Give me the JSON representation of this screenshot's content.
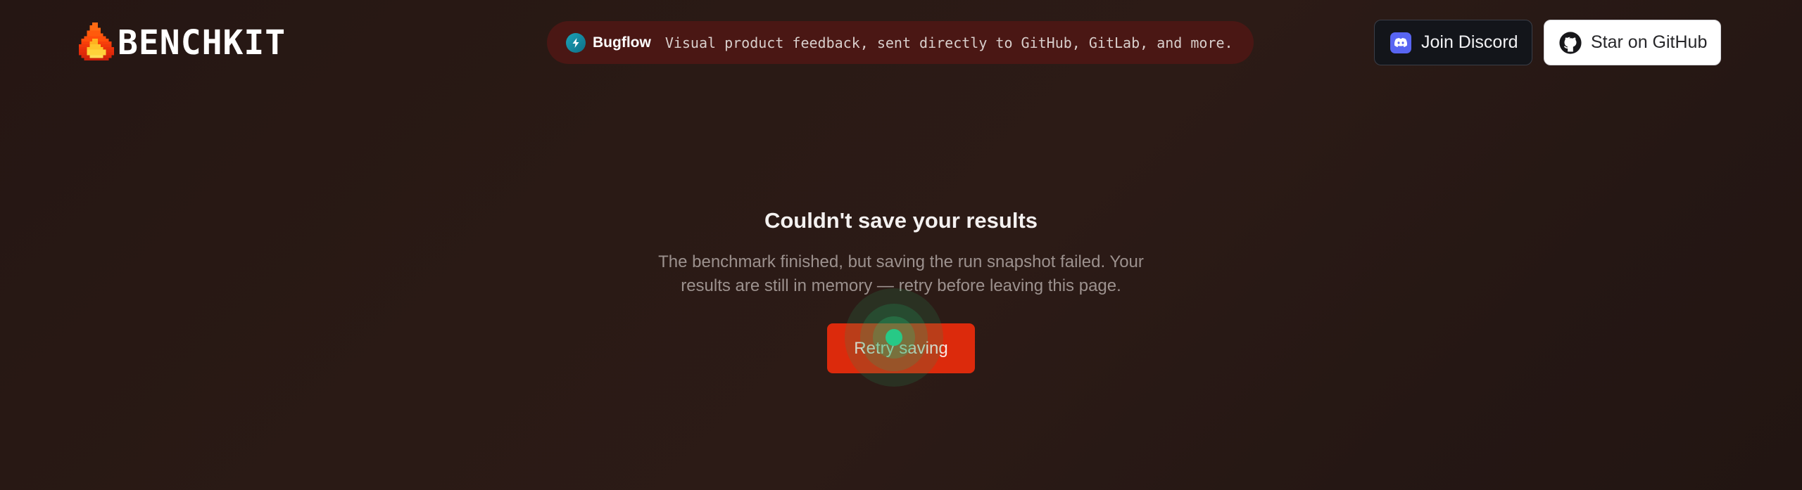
{
  "header": {
    "brand_name": "BENCHKIT",
    "promo": {
      "brand": "Bugflow",
      "text": "Visual product feedback, sent directly to GitHub, GitLab, and more.",
      "background": "#4a1714"
    },
    "discord_label": "Join Discord",
    "github_label": "Star on GitHub"
  },
  "main": {
    "title": "Couldn't save your results",
    "description": "The benchmark finished, but saving the run snapshot failed. Your results are still in memory — retry before leaving this page.",
    "retry_label": "Retry saving"
  },
  "colors": {
    "background": "#2a1a15",
    "accent": "#dc2a0c",
    "discord": "#5865f2",
    "click_indicator": "#27c986"
  },
  "icons": {
    "logo": "flame-icon",
    "promo": "lightning-bolt-icon",
    "discord": "discord-icon",
    "github": "github-icon"
  }
}
